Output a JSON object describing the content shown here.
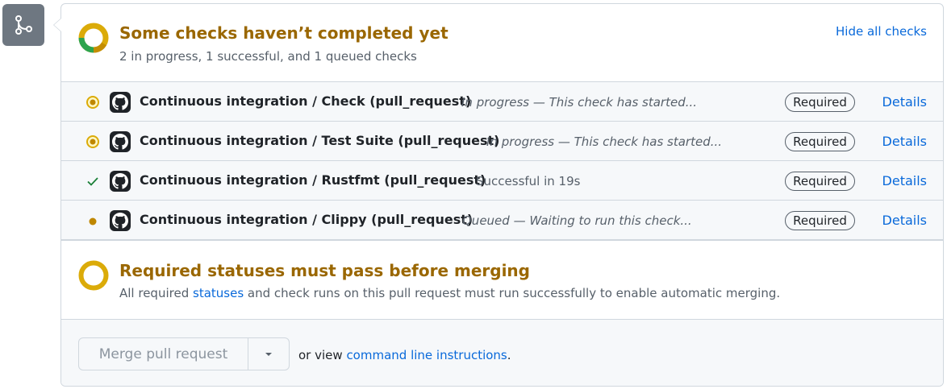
{
  "summary": {
    "title": "Some checks haven’t completed yet",
    "subtitle": "2 in progress, 1 successful, and 1 queued checks",
    "hide_link": "Hide all checks"
  },
  "checks": [
    {
      "name": "Continuous integration / Check (pull_request)",
      "status": "in-progress",
      "description": "In progress — This check has started...",
      "required_label": "Required",
      "details_label": "Details"
    },
    {
      "name": "Continuous integration / Test Suite (pull_request)",
      "status": "in-progress",
      "description": "In progress — This check has started...",
      "required_label": "Required",
      "details_label": "Details"
    },
    {
      "name": "Continuous integration / Rustfmt (pull_request)",
      "status": "success",
      "description": "Successful in 19s",
      "required_label": "Required",
      "details_label": "Details"
    },
    {
      "name": "Continuous integration / Clippy (pull_request)",
      "status": "queued",
      "description": "Queued — Waiting to run this check...",
      "required_label": "Required",
      "details_label": "Details"
    }
  ],
  "required_statuses": {
    "title": "Required statuses must pass before merging",
    "text_before": "All required",
    "link": "statuses",
    "text_after": "and check runs on this pull request must run successfully to enable automatic merging."
  },
  "merge": {
    "button_label": "Merge pull request",
    "help_prefix": "or view",
    "help_link": "command line instructions",
    "help_suffix": "."
  },
  "colors": {
    "pending": "#9a6700",
    "pending_ring": "#dbab09",
    "success": "#1a7f37",
    "link": "#0969da"
  },
  "icons": {
    "merge_box": "git-merge-icon",
    "check_avatar": "github-logo-icon",
    "merge_dropdown": "triangle-down-icon"
  }
}
